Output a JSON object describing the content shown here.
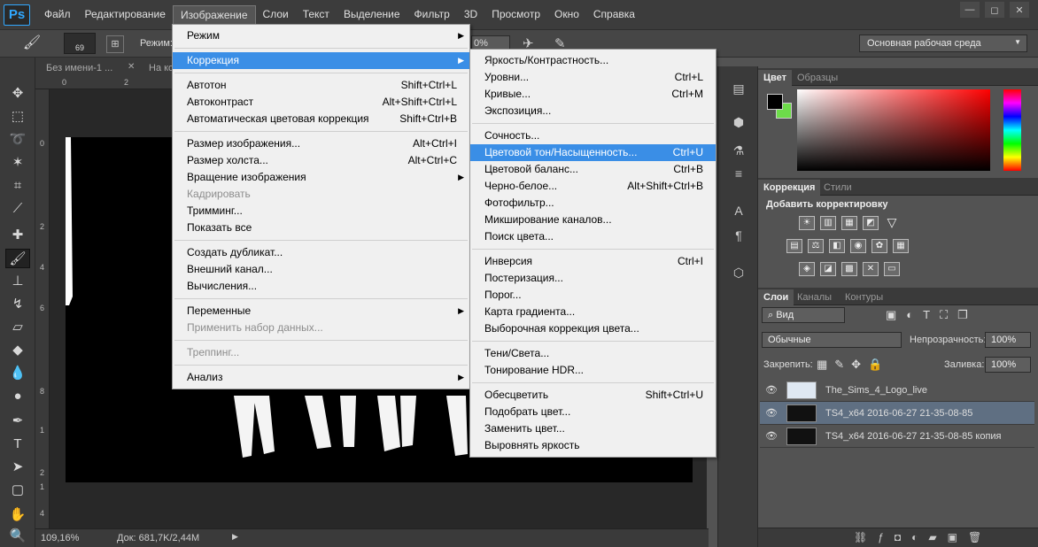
{
  "menubar": {
    "logo": "Ps",
    "items": [
      "Файл",
      "Редактирование",
      "Изображение",
      "Слои",
      "Текст",
      "Выделение",
      "Фильтр",
      "3D",
      "Просмотр",
      "Окно",
      "Справка"
    ],
    "active_index": 2
  },
  "window_controls": {
    "minimize": "—",
    "restore": "◻",
    "close": "✕"
  },
  "options_bar": {
    "brush_size": "69",
    "mode_label": "Режим:",
    "opacity_value": "0%",
    "workspace": "Основная рабочая среда"
  },
  "doc_tabs": [
    {
      "label": "Без имени-1 ..."
    },
    {
      "label": "На ко"
    }
  ],
  "ruler": {
    "h_marks": [
      "0",
      "2"
    ],
    "v_marks": [
      "0",
      "2",
      "4",
      "6",
      "8",
      "1",
      "2",
      "1",
      "4"
    ]
  },
  "status": {
    "zoom": "109,16%",
    "doc": "Док: 681,7K/2,44M"
  },
  "image_menu": {
    "groups": [
      [
        {
          "label": "Режим",
          "submenu": true
        }
      ],
      [
        {
          "label": "Коррекция",
          "submenu": true,
          "highlighted": true
        }
      ],
      [
        {
          "label": "Автотон",
          "shortcut": "Shift+Ctrl+L"
        },
        {
          "label": "Автоконтраст",
          "shortcut": "Alt+Shift+Ctrl+L"
        },
        {
          "label": "Автоматическая цветовая коррекция",
          "shortcut": "Shift+Ctrl+B"
        }
      ],
      [
        {
          "label": "Размер изображения...",
          "shortcut": "Alt+Ctrl+I"
        },
        {
          "label": "Размер холста...",
          "shortcut": "Alt+Ctrl+C"
        },
        {
          "label": "Вращение изображения",
          "submenu": true
        },
        {
          "label": "Кадрировать",
          "disabled": true
        },
        {
          "label": "Тримминг..."
        },
        {
          "label": "Показать все"
        }
      ],
      [
        {
          "label": "Создать дубликат..."
        },
        {
          "label": "Внешний канал..."
        },
        {
          "label": "Вычисления..."
        }
      ],
      [
        {
          "label": "Переменные",
          "submenu": true
        },
        {
          "label": "Применить набор данных...",
          "disabled": true
        }
      ],
      [
        {
          "label": "Треппинг...",
          "disabled": true
        }
      ],
      [
        {
          "label": "Анализ",
          "submenu": true
        }
      ]
    ]
  },
  "correction_menu": {
    "groups": [
      [
        {
          "label": "Яркость/Контрастность..."
        },
        {
          "label": "Уровни...",
          "shortcut": "Ctrl+L"
        },
        {
          "label": "Кривые...",
          "shortcut": "Ctrl+M"
        },
        {
          "label": "Экспозиция..."
        }
      ],
      [
        {
          "label": "Сочность..."
        },
        {
          "label": "Цветовой тон/Насыщенность...",
          "shortcut": "Ctrl+U",
          "highlighted": true
        },
        {
          "label": "Цветовой баланс...",
          "shortcut": "Ctrl+B"
        },
        {
          "label": "Черно-белое...",
          "shortcut": "Alt+Shift+Ctrl+B"
        },
        {
          "label": "Фотофильтр..."
        },
        {
          "label": "Микширование каналов..."
        },
        {
          "label": "Поиск цвета..."
        }
      ],
      [
        {
          "label": "Инверсия",
          "shortcut": "Ctrl+I"
        },
        {
          "label": "Постеризация..."
        },
        {
          "label": "Порог..."
        },
        {
          "label": "Карта градиента..."
        },
        {
          "label": "Выборочная коррекция цвета..."
        }
      ],
      [
        {
          "label": "Тени/Света..."
        },
        {
          "label": "Тонирование HDR..."
        }
      ],
      [
        {
          "label": "Обесцветить",
          "shortcut": "Shift+Ctrl+U"
        },
        {
          "label": "Подобрать цвет..."
        },
        {
          "label": "Заменить цвет..."
        },
        {
          "label": "Выровнять яркость"
        }
      ]
    ]
  },
  "color_panel": {
    "tabs": [
      "Цвет",
      "Образцы"
    ],
    "fg_color": "#000000",
    "bg_color": "#6ddc4a"
  },
  "adjustments_panel": {
    "tabs": [
      "Коррекция",
      "Стили"
    ],
    "title": "Добавить корректировку"
  },
  "layers_panel": {
    "tabs": [
      "Слои",
      "Каналы",
      "Контуры"
    ],
    "filter": "Вид",
    "blend_mode": "Обычные",
    "opacity_label": "Непрозрачность:",
    "opacity_value": "100%",
    "lock_label": "Закрепить:",
    "fill_label": "Заливка:",
    "fill_value": "100%",
    "layers": [
      {
        "name": "The_Sims_4_Logo_live",
        "selected": false
      },
      {
        "name": "TS4_x64 2016-06-27 21-35-08-85",
        "selected": true
      },
      {
        "name": "TS4_x64 2016-06-27 21-35-08-85 копия",
        "selected": false
      }
    ]
  }
}
